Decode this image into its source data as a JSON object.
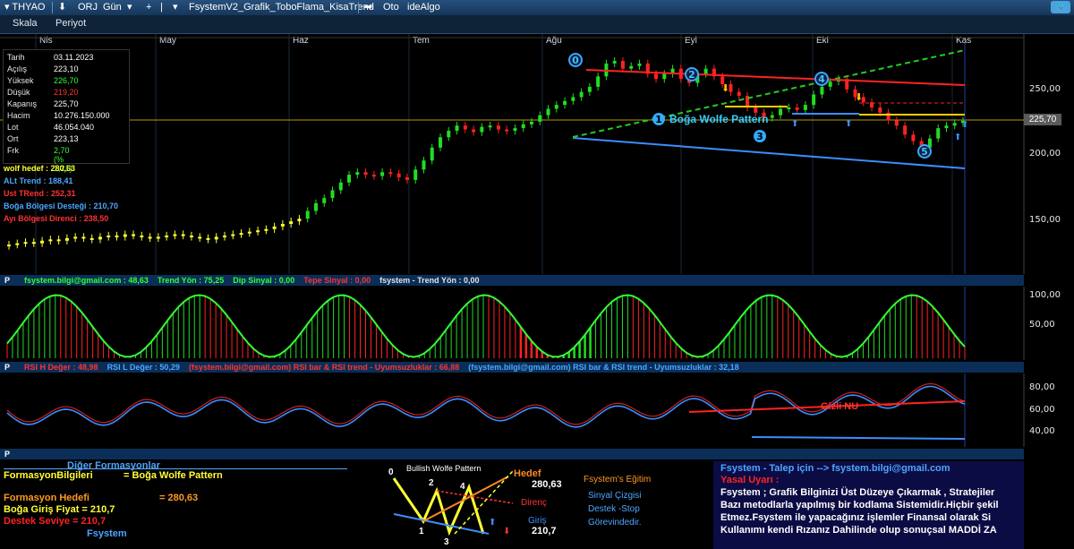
{
  "toolbar": {
    "symbol": "THYAO",
    "orj": "ORJ",
    "period": "Gün",
    "plus": "+",
    "formula": "FsystemV2_Grafik_ToboFlama_KisaTrend",
    "oto": "Oto",
    "idealgo": "ideAlgo",
    "skala": "Skala",
    "periyot": "Periyot"
  },
  "months": [
    "Nis",
    "May",
    "Haz",
    "Tem",
    "Ağu",
    "Eyl",
    "Eki",
    "Kas"
  ],
  "info": {
    "rows": [
      {
        "k": "Tarih",
        "v": "03.11.2023",
        "color": "#ffffff"
      },
      {
        "k": "Açılış",
        "v": "223,10",
        "color": "#ffffff"
      },
      {
        "k": "Yüksek",
        "v": "226,70",
        "color": "#33ff33"
      },
      {
        "k": "Düşük",
        "v": "219,20",
        "color": "#ff3333"
      },
      {
        "k": "Kapanış",
        "v": "225,70",
        "color": "#ffffff"
      },
      {
        "k": "Hacim",
        "v": "10.276.150.000",
        "color": "#ffffff"
      },
      {
        "k": "Lot",
        "v": "46.054.040",
        "color": "#ffffff"
      },
      {
        "k": "Ort",
        "v": "223,13",
        "color": "#ffffff"
      },
      {
        "k": "Frk",
        "v": "2,70 (% 1,21)",
        "color": "#33ff33"
      }
    ]
  },
  "levels": [
    {
      "text": "wolf hedef :  280,63",
      "color": "#ffff33"
    },
    {
      "text": "ALt Trend :  188,41",
      "color": "#4da6ff"
    },
    {
      "text": "Ust TRend :  252,31",
      "color": "#ff3333"
    },
    {
      "text": "Boğa Bölgesi Desteği :  210,70",
      "color": "#4da6ff"
    },
    {
      "text": "Ayı Bölgesi Direnci :  238,50",
      "color": "#ff3333"
    }
  ],
  "price_axis": [
    "250,00",
    "200,00",
    "150,00"
  ],
  "current_price": "225,70",
  "pattern_label": "Boğa Wolfe Pattern",
  "pattern_points": [
    "0",
    "1",
    "2",
    "3",
    "4",
    "5"
  ],
  "panel1": {
    "p": "P",
    "items": [
      {
        "text": "fsystem.bilgi@gmail.com :  48,63",
        "color": "#33ff33"
      },
      {
        "text": "Trend Yön :  75,25",
        "color": "#33ff33"
      },
      {
        "text": "Dip Sinyal :  0,00",
        "color": "#33ff33"
      },
      {
        "text": "Tepe Sinyal :  0,00",
        "color": "#ff3333"
      },
      {
        "text": "fsystem - Trend Yön :  0,00",
        "color": "#e0e0e0"
      }
    ],
    "axis": [
      "100,00",
      "50,00"
    ]
  },
  "panel2": {
    "p": "P",
    "items": [
      {
        "text": "RSI H Değer :  48,98",
        "color": "#ff3333"
      },
      {
        "text": "RSI L Değer :  50,29",
        "color": "#4da6ff"
      },
      {
        "text": "(fsystem.bilgi@gmail.com) RSI bar & RSI trend - Uyumsuzluklar :  66,88",
        "color": "#ff3333"
      },
      {
        "text": "(fsystem.bilgi@gmail.com) RSI bar & RSI trend - Uyumsuzluklar :  32,18",
        "color": "#4da6ff"
      }
    ],
    "axis": [
      "80,00",
      "60,00",
      "40,00"
    ],
    "divergence_label": "Gizli NU"
  },
  "panel3": {
    "p": "P"
  },
  "bottom": {
    "diger": "Diğer Formasyonlar",
    "formasyon_key": "FormasyonBilgileri",
    "formasyon_val": "= Boğa Wolfe Pattern",
    "hedef_key": "Formasyon Hedefi",
    "hedef_val": "= 280,63",
    "giris": "Boğa Giriş Fiyat = 210,7",
    "destek": "Destek Seviye    = 210,7",
    "fsystem": "Fsystem",
    "diagram_title": "Bullish Wolfe Pattern",
    "diagram_hedef": "Hedef",
    "diagram_hedef_val": "280,63",
    "diagram_direnc": "Direnç",
    "diagram_giris": "Giriş",
    "diagram_giris_val": "210,7",
    "diagram_nums": [
      "0",
      "1",
      "2",
      "3",
      "4"
    ],
    "egitim": [
      "Fsystem's Eğitim",
      "Sinyal Çizgisi",
      "Destek -Stop",
      "Görevindedir."
    ]
  },
  "yasal": {
    "line1": "Fsystem - Talep için --> fsystem.bilgi@gmail.com",
    "line2": "Yasal Uyarı :",
    "line3": "Fsystem ; Grafik Bilginizi Üst Düzeye Çıkarmak , Stratejiler",
    "line4": "Bazı metodlarla yapılmış bir kodlama Sistemidir.Hiçbir şekil",
    "line5": "Etmez.Fsystem ile yapacağınız işlemler Finansal olarak Si",
    "line6": "Kullanımı kendi Rızanız Dahilinde olup sonuçsal MADDİ ZA"
  },
  "chart_data": {
    "type": "candlestick",
    "ylim": [
      110,
      290
    ],
    "closes": [
      130,
      131,
      132,
      131,
      133,
      134,
      133,
      135,
      136,
      135,
      134,
      136,
      137,
      136,
      138,
      137,
      136,
      135,
      136,
      137,
      138,
      137,
      136,
      135,
      134,
      136,
      137,
      138,
      139,
      140,
      141,
      142,
      144,
      146,
      148,
      150,
      156,
      162,
      166,
      172,
      178,
      184,
      186,
      184,
      183,
      186,
      185,
      182,
      180,
      188,
      195,
      205,
      213,
      218,
      222,
      219,
      217,
      221,
      222,
      219,
      218,
      220,
      223,
      225,
      230,
      235,
      238,
      241,
      244,
      248,
      252,
      260,
      270,
      272,
      266,
      268,
      270,
      262,
      258,
      262,
      266,
      258,
      255,
      262,
      266,
      260,
      254,
      248,
      245,
      236,
      232,
      228,
      230,
      235,
      236,
      234,
      238,
      246,
      252,
      256,
      258,
      250,
      244,
      240,
      236,
      232,
      226,
      222,
      215,
      210,
      205,
      212,
      220,
      222,
      224,
      225.7
    ],
    "wolf_hedef": 280.63,
    "alt_trend": 188.41,
    "ust_trend": 252.31,
    "boga_destek": 210.7,
    "ayi_direnc": 238.5
  }
}
